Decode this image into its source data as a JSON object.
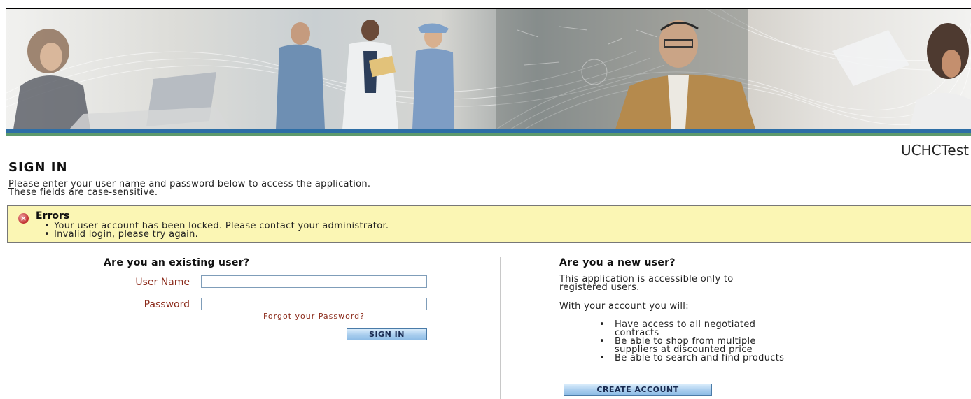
{
  "header": {
    "app_name": "UCHCTest"
  },
  "page": {
    "title": "SIGN IN",
    "intro_line1": "Please enter your user name and password below to access the application.",
    "intro_line2": "These fields are case-sensitive."
  },
  "errors": {
    "title": "Errors",
    "items": [
      "Your user account has been locked. Please contact your administrator.",
      "Invalid login, please try again."
    ]
  },
  "existing_user": {
    "heading": "Are you an existing user?",
    "username_label": "User Name",
    "username_value": "",
    "password_label": "Password",
    "password_value": "",
    "forgot_link": "Forgot your Password?",
    "sign_in_button": "SIGN IN"
  },
  "new_user": {
    "heading": "Are you a new user?",
    "info_line1": "This application is accessible only to",
    "info_line2": "registered users.",
    "benefits_intro": "With your account you will:",
    "benefits": [
      [
        "Have access to all negotiated",
        "contracts"
      ],
      [
        "Be able to shop from multiple",
        "suppliers at discounted price"
      ],
      [
        "Be able to search and find products"
      ]
    ],
    "create_button": "CREATE ACCOUNT"
  },
  "colors": {
    "label_red": "#8b2a1a",
    "error_bg": "#fbf6b4",
    "banner_stripe": "#2d6ea6",
    "button_blue": "#a9cdee"
  }
}
